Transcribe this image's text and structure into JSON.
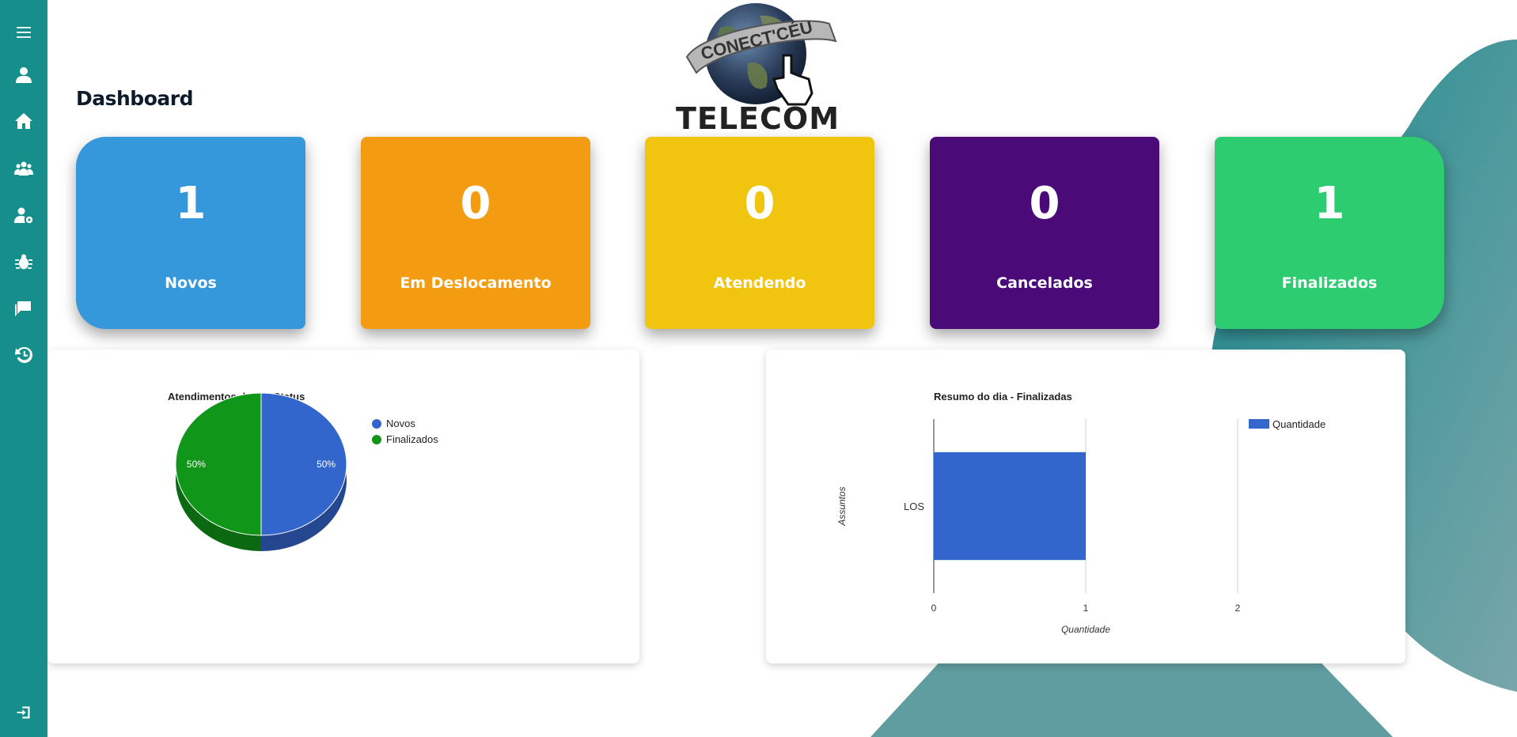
{
  "page": {
    "title": "Dashboard"
  },
  "logo": {
    "arc_text": "CONECT'CÉU",
    "brand_text": "TELECOM"
  },
  "colors": {
    "sidebar": "#168f8c",
    "accent": "#1a8e91"
  },
  "sidebar": {
    "items": [
      {
        "icon": "menu-icon"
      },
      {
        "icon": "user-icon"
      },
      {
        "icon": "home-icon"
      },
      {
        "icon": "users-group-icon"
      },
      {
        "icon": "user-settings-icon"
      },
      {
        "icon": "bug-icon"
      },
      {
        "icon": "messages-icon"
      },
      {
        "icon": "history-icon"
      },
      {
        "icon": "logout-icon"
      }
    ]
  },
  "cards": [
    {
      "value": "1",
      "label": "Novos",
      "color": "#3498db"
    },
    {
      "value": "0",
      "label": "Em Deslocamento",
      "color": "#f39c12"
    },
    {
      "value": "0",
      "label": "Atendendo",
      "color": "#f1c40f"
    },
    {
      "value": "0",
      "label": "Cancelados",
      "color": "#4a0a78"
    },
    {
      "value": "1",
      "label": "Finalizados",
      "color": "#2ecc71"
    }
  ],
  "chart_data": [
    {
      "type": "pie",
      "title": "Atendimentos do Dia Status",
      "series": [
        {
          "name": "Novos",
          "value": 1,
          "label": "50%",
          "color": "#3366cc"
        },
        {
          "name": "Finalizados",
          "value": 1,
          "label": "50%",
          "color": "#109618"
        }
      ],
      "legend": "right",
      "three_d": true
    },
    {
      "type": "bar",
      "orientation": "horizontal",
      "title": "Resumo do dia - Finalizadas",
      "categories": [
        "LOS"
      ],
      "series": [
        {
          "name": "Quantidade",
          "values": [
            1
          ],
          "color": "#3366cc"
        }
      ],
      "xlabel": "Quantidade",
      "ylabel": "Assuntos",
      "xlim": [
        0,
        2
      ],
      "xticks": [
        "0",
        "1",
        "2"
      ],
      "legend": "top-right",
      "grid": true
    }
  ]
}
